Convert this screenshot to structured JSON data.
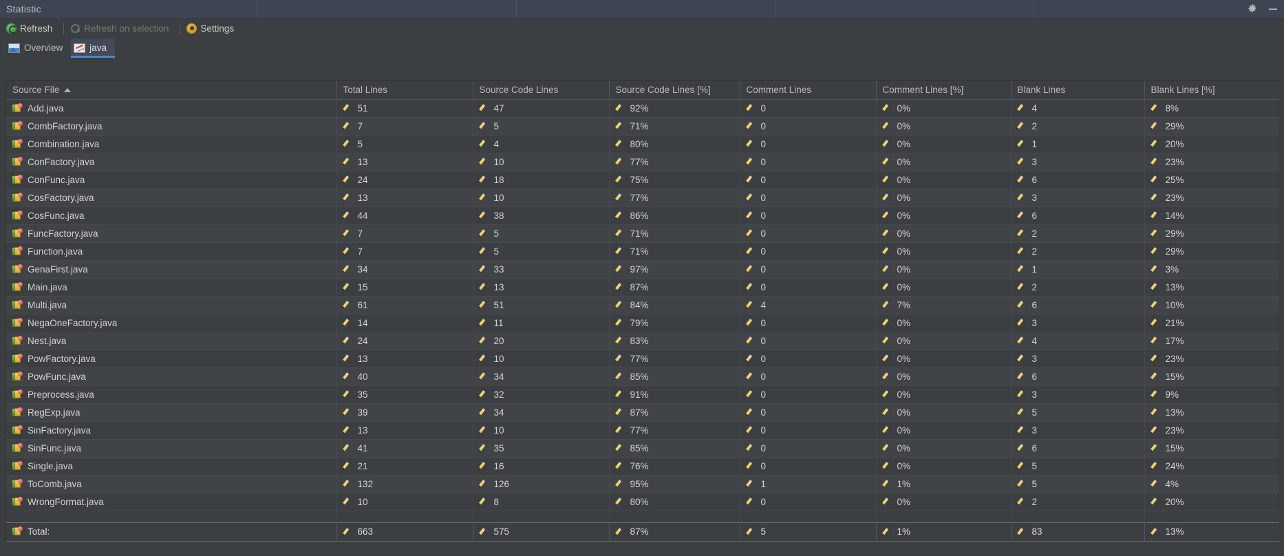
{
  "window": {
    "title": "Statistic",
    "controls": [
      {
        "name": "gear-icon",
        "label": "Settings"
      },
      {
        "name": "minimize-icon",
        "label": "Hide"
      }
    ]
  },
  "toolbar": {
    "refresh": {
      "label": "Refresh",
      "icon": "refresh-icon",
      "enabled": true
    },
    "refresh_on_selection": {
      "label": "Refresh on selection",
      "icon": "magnifier-icon",
      "enabled": false
    },
    "settings": {
      "label": "Settings",
      "icon": "settings-icon",
      "enabled": true
    }
  },
  "tabs": [
    {
      "label": "Overview",
      "icon": "overview-icon",
      "active": false
    },
    {
      "label": "java",
      "icon": "java-chart-icon",
      "active": true
    }
  ],
  "table": {
    "sort_column": "Source File",
    "sort_direction": "asc",
    "columns": [
      "Source File",
      "Total Lines",
      "Source Code Lines",
      "Source Code Lines [%]",
      "Comment Lines",
      "Comment Lines [%]",
      "Blank Lines",
      "Blank Lines [%]"
    ],
    "rows": [
      {
        "file": "Add.java",
        "total": "51",
        "src": "47",
        "src_pct": "92%",
        "comment": "0",
        "comment_pct": "0%",
        "blank": "4",
        "blank_pct": "8%"
      },
      {
        "file": "CombFactory.java",
        "total": "7",
        "src": "5",
        "src_pct": "71%",
        "comment": "0",
        "comment_pct": "0%",
        "blank": "2",
        "blank_pct": "29%"
      },
      {
        "file": "Combination.java",
        "total": "5",
        "src": "4",
        "src_pct": "80%",
        "comment": "0",
        "comment_pct": "0%",
        "blank": "1",
        "blank_pct": "20%"
      },
      {
        "file": "ConFactory.java",
        "total": "13",
        "src": "10",
        "src_pct": "77%",
        "comment": "0",
        "comment_pct": "0%",
        "blank": "3",
        "blank_pct": "23%"
      },
      {
        "file": "ConFunc.java",
        "total": "24",
        "src": "18",
        "src_pct": "75%",
        "comment": "0",
        "comment_pct": "0%",
        "blank": "6",
        "blank_pct": "25%"
      },
      {
        "file": "CosFactory.java",
        "total": "13",
        "src": "10",
        "src_pct": "77%",
        "comment": "0",
        "comment_pct": "0%",
        "blank": "3",
        "blank_pct": "23%"
      },
      {
        "file": "CosFunc.java",
        "total": "44",
        "src": "38",
        "src_pct": "86%",
        "comment": "0",
        "comment_pct": "0%",
        "blank": "6",
        "blank_pct": "14%"
      },
      {
        "file": "FuncFactory.java",
        "total": "7",
        "src": "5",
        "src_pct": "71%",
        "comment": "0",
        "comment_pct": "0%",
        "blank": "2",
        "blank_pct": "29%"
      },
      {
        "file": "Function.java",
        "total": "7",
        "src": "5",
        "src_pct": "71%",
        "comment": "0",
        "comment_pct": "0%",
        "blank": "2",
        "blank_pct": "29%"
      },
      {
        "file": "GenaFirst.java",
        "total": "34",
        "src": "33",
        "src_pct": "97%",
        "comment": "0",
        "comment_pct": "0%",
        "blank": "1",
        "blank_pct": "3%"
      },
      {
        "file": "Main.java",
        "total": "15",
        "src": "13",
        "src_pct": "87%",
        "comment": "0",
        "comment_pct": "0%",
        "blank": "2",
        "blank_pct": "13%"
      },
      {
        "file": "Multi.java",
        "total": "61",
        "src": "51",
        "src_pct": "84%",
        "comment": "4",
        "comment_pct": "7%",
        "blank": "6",
        "blank_pct": "10%"
      },
      {
        "file": "NegaOneFactory.java",
        "total": "14",
        "src": "11",
        "src_pct": "79%",
        "comment": "0",
        "comment_pct": "0%",
        "blank": "3",
        "blank_pct": "21%"
      },
      {
        "file": "Nest.java",
        "total": "24",
        "src": "20",
        "src_pct": "83%",
        "comment": "0",
        "comment_pct": "0%",
        "blank": "4",
        "blank_pct": "17%"
      },
      {
        "file": "PowFactory.java",
        "total": "13",
        "src": "10",
        "src_pct": "77%",
        "comment": "0",
        "comment_pct": "0%",
        "blank": "3",
        "blank_pct": "23%"
      },
      {
        "file": "PowFunc.java",
        "total": "40",
        "src": "34",
        "src_pct": "85%",
        "comment": "0",
        "comment_pct": "0%",
        "blank": "6",
        "blank_pct": "15%"
      },
      {
        "file": "Preprocess.java",
        "total": "35",
        "src": "32",
        "src_pct": "91%",
        "comment": "0",
        "comment_pct": "0%",
        "blank": "3",
        "blank_pct": "9%"
      },
      {
        "file": "RegExp.java",
        "total": "39",
        "src": "34",
        "src_pct": "87%",
        "comment": "0",
        "comment_pct": "0%",
        "blank": "5",
        "blank_pct": "13%"
      },
      {
        "file": "SinFactory.java",
        "total": "13",
        "src": "10",
        "src_pct": "77%",
        "comment": "0",
        "comment_pct": "0%",
        "blank": "3",
        "blank_pct": "23%"
      },
      {
        "file": "SinFunc.java",
        "total": "41",
        "src": "35",
        "src_pct": "85%",
        "comment": "0",
        "comment_pct": "0%",
        "blank": "6",
        "blank_pct": "15%"
      },
      {
        "file": "Single.java",
        "total": "21",
        "src": "16",
        "src_pct": "76%",
        "comment": "0",
        "comment_pct": "0%",
        "blank": "5",
        "blank_pct": "24%"
      },
      {
        "file": "ToComb.java",
        "total": "132",
        "src": "126",
        "src_pct": "95%",
        "comment": "1",
        "comment_pct": "1%",
        "blank": "5",
        "blank_pct": "4%"
      },
      {
        "file": "WrongFormat.java",
        "total": "10",
        "src": "8",
        "src_pct": "80%",
        "comment": "0",
        "comment_pct": "0%",
        "blank": "2",
        "blank_pct": "20%"
      }
    ],
    "total": {
      "file": "Total:",
      "total": "663",
      "src": "575",
      "src_pct": "87%",
      "comment": "5",
      "comment_pct": "1%",
      "blank": "83",
      "blank_pct": "13%"
    }
  },
  "colors": {
    "window_bg": "#3c3f41",
    "titlebar_bg": "#3f4453",
    "tab_active_bg": "#44495a",
    "tab_accent": "#4a88c7",
    "text": "#d2d2d2",
    "grid": "#464a4c"
  }
}
